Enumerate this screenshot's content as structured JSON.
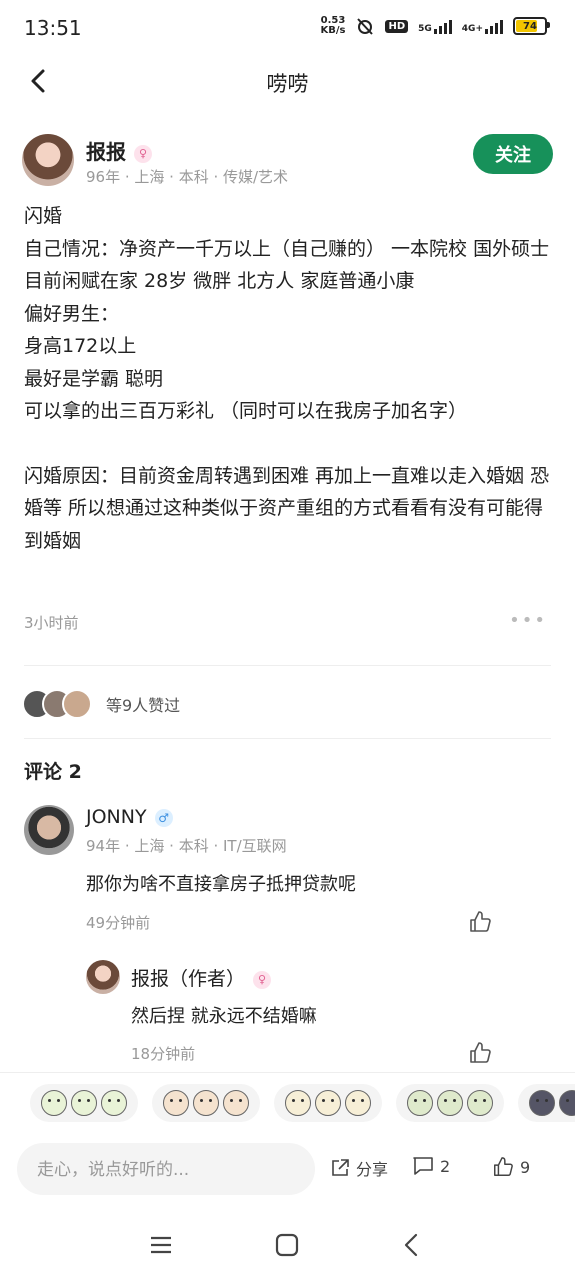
{
  "status_bar": {
    "time": "13:51",
    "net_speed_top": "0.53",
    "net_speed_unit": "KB/s",
    "hd": "HD",
    "net1": "5G",
    "net2": "4G+",
    "battery": "74"
  },
  "header": {
    "title": "唠唠"
  },
  "post": {
    "author_name": "报报",
    "author_meta": "96年 · 上海 · 本科 · 传媒/艺术",
    "follow_label": "关注",
    "body_lines": [
      "闪婚",
      "自己情况：净资产一千万以上（自己赚的） 一本院校 国外硕士 目前闲赋在家 28岁 微胖 北方人 家庭普通小康",
      "偏好男生：",
      "身高172以上",
      "最好是学霸 聪明",
      "可以拿的出三百万彩礼 （同时可以在我房子加名字）"
    ],
    "body_reason": "闪婚原因：目前资金周转遇到困难 再加上一直难以走入婚姻 恐婚等 所以想通过这种类似于资产重组的方式看看有没有可能得到婚姻",
    "time": "3小时前",
    "likes_text": "等9人赞过"
  },
  "comments": {
    "heading": "评论 2",
    "items": [
      {
        "name": "JONNY",
        "meta": "94年 · 上海 · 本科 · IT/互联网",
        "text": "那你为啥不直接拿房子抵押贷款呢",
        "time": "49分钟前"
      },
      {
        "name": "报报（作者）",
        "text": "然后捏 就永远不结婚嘛",
        "time": "18分钟前"
      }
    ]
  },
  "bottom": {
    "input_placeholder": "走心，说点好听的...",
    "share_label": "分享",
    "comment_count": "2",
    "like_count": "9"
  },
  "colors": {
    "accent": "#17915a"
  }
}
